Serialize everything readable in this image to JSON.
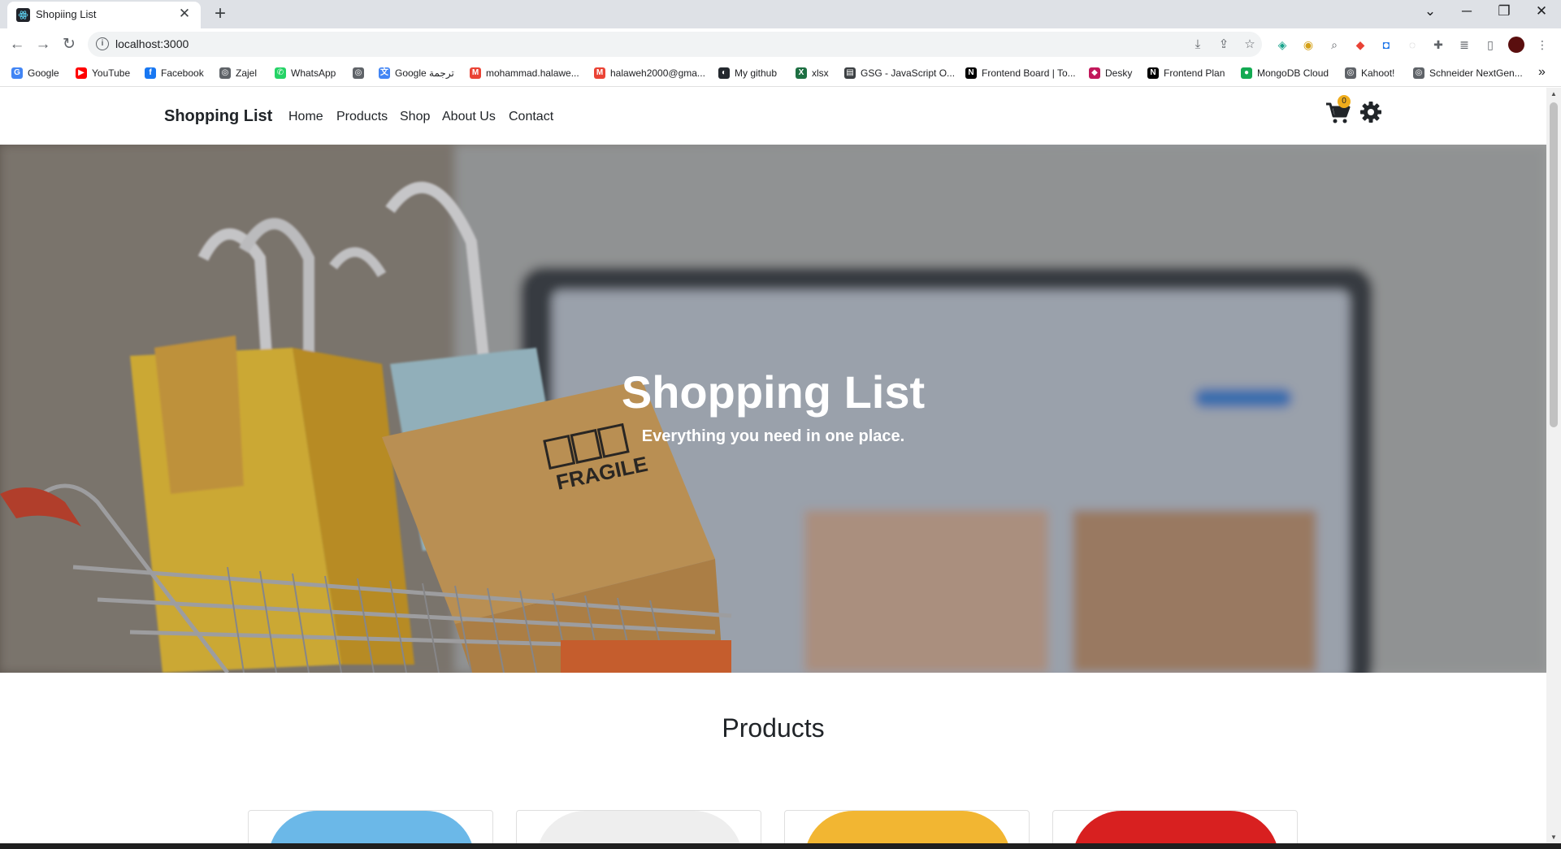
{
  "browser": {
    "tab_title": "Shopiing List",
    "tab_close": "✕",
    "new_tab": "+",
    "url": "localhost:3000",
    "window_controls": {
      "minimize": "─",
      "restore": "❐",
      "close": "✕",
      "tab_search": "⌄"
    }
  },
  "bookmarks": [
    {
      "label": "Google",
      "icon": "google-icon",
      "color": "#4285f4"
    },
    {
      "label": "YouTube",
      "icon": "youtube-icon",
      "color": "#ff0000"
    },
    {
      "label": "Facebook",
      "icon": "facebook-icon",
      "color": "#1877f2"
    },
    {
      "label": "Zajel",
      "icon": "globe-icon",
      "color": "#5f6368"
    },
    {
      "label": "WhatsApp",
      "icon": "whatsapp-icon",
      "color": "#25d366"
    },
    {
      "label": "",
      "icon": "globe-icon",
      "color": "#5f6368"
    },
    {
      "label": "Google ترجمة",
      "icon": "translate-icon",
      "color": "#4285f4"
    },
    {
      "label": "mohammad.halawe...",
      "icon": "gmail-icon",
      "color": "#ea4335"
    },
    {
      "label": "halaweh2000@gma...",
      "icon": "gmail-icon",
      "color": "#ea4335"
    },
    {
      "label": "My github",
      "icon": "github-icon",
      "color": "#24292f"
    },
    {
      "label": "xlsx",
      "icon": "excel-icon",
      "color": "#1d6f42"
    },
    {
      "label": "GSG - JavaScript O...",
      "icon": "doc-icon",
      "color": "#3c4043"
    },
    {
      "label": "Frontend Board | To...",
      "icon": "notion-icon",
      "color": "#000000"
    },
    {
      "label": "Desky",
      "icon": "desky-icon",
      "color": "#c2185b"
    },
    {
      "label": "Frontend Plan",
      "icon": "notion-icon",
      "color": "#000000"
    },
    {
      "label": "MongoDB Cloud",
      "icon": "mongodb-icon",
      "color": "#13aa52"
    },
    {
      "label": "Kahoot!",
      "icon": "globe-icon",
      "color": "#5f6368"
    },
    {
      "label": "Schneider NextGen...",
      "icon": "globe-icon",
      "color": "#5f6368"
    }
  ],
  "bookmarks_more": "»",
  "site": {
    "brand": "Shopping List",
    "nav": [
      "Home",
      "Products",
      "Shop",
      "About Us",
      "Contact"
    ],
    "cart_count": "0"
  },
  "hero": {
    "title": "Shopping List",
    "subtitle": "Everything you need in one place."
  },
  "products": {
    "title": "Products",
    "cards": [
      {
        "color": "#6bb8e8"
      },
      {
        "color": "#eeeeee"
      },
      {
        "color": "#f2b632"
      },
      {
        "color": "#d82020"
      }
    ]
  },
  "colors": {
    "accent_badge": "#f0ad1c",
    "text_dark": "#212529"
  }
}
